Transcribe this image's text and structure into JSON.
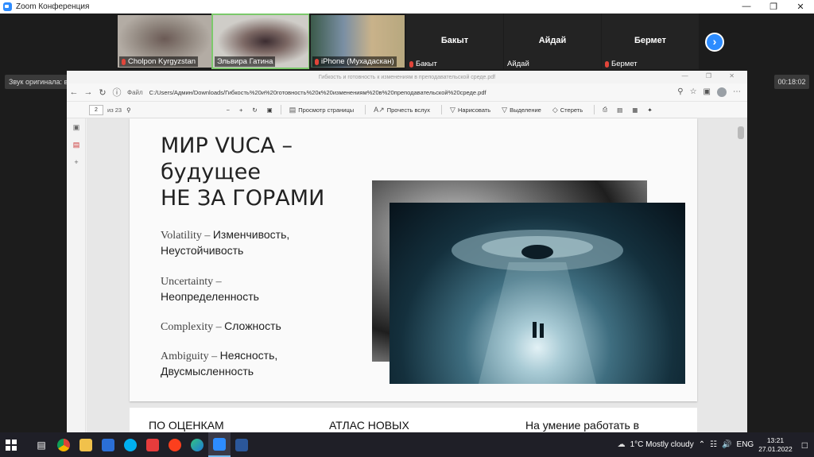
{
  "window": {
    "title": "Zoom Конференция"
  },
  "participants": [
    {
      "name": "Cholpon Kyrgyzstan",
      "muted": true
    },
    {
      "name": "Эльвира Гатина",
      "muted": false
    },
    {
      "name": "iPhone (Мухадаскан)",
      "muted": true
    },
    {
      "name": "Бакыт",
      "label": "Бакыт",
      "muted": true
    },
    {
      "name": "Айдай",
      "label": "Айдай",
      "muted": false
    },
    {
      "name": "Бермет",
      "label": "Бермет",
      "muted": true
    }
  ],
  "controls": {
    "original_sound": "Звук оригинала: выкл.",
    "timer": "00:18:02"
  },
  "browser": {
    "tab_title": "Гибкость и готовность к изменениям в преподавательской среде.pdf",
    "file_label": "Файл",
    "url": "C:/Users/Админ/Downloads/Гибкость%20и%20готовность%20к%20изменениям%20в%20преподавательской%20среде.pdf",
    "page_current": "2",
    "page_total": "из 23",
    "toolbar": {
      "page_view": "Просмотр страницы",
      "read_aloud": "Прочесть вслух",
      "draw": "Нарисовать",
      "highlight": "Выделение",
      "erase": "Стереть"
    }
  },
  "slide": {
    "title": "МИР VUCA –\nбудущее\nНЕ ЗА ГОРАМИ",
    "items": [
      {
        "en": "Volatility",
        "sep": " – ",
        "ru": "Изменчивость, Неустойчивость"
      },
      {
        "en": "Uncertainty",
        "sep": " – ",
        "ru": "Неопределенность"
      },
      {
        "en": "Complexity",
        "sep": " – ",
        "ru": "Сложность"
      },
      {
        "en": "Ambiguity",
        "sep": " – ",
        "ru": "Неясность, Двусмысленность"
      }
    ]
  },
  "next_slide": {
    "col1": "ПО ОЦЕНКАМ",
    "col2": "АТЛАС НОВЫХ",
    "col3": "На умение работать в"
  },
  "taskbar": {
    "weather": "1°C  Mostly cloudy",
    "language": "ENG",
    "time": "13:21",
    "date": "27.01.2022"
  }
}
